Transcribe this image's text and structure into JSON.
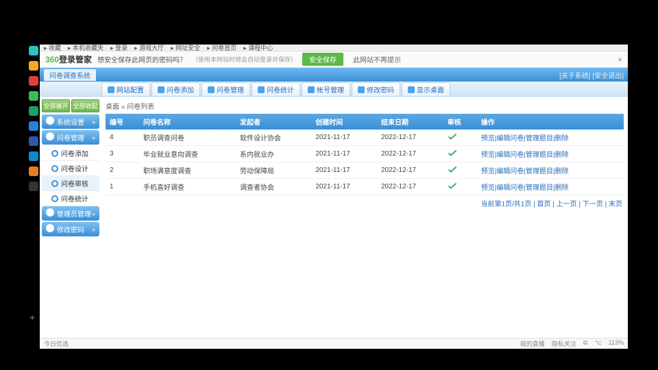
{
  "topstrip": [
    "收藏",
    "本机收藏夹",
    "登录",
    "游戏大厅",
    "网址安全",
    "问卷首页",
    "课程中心"
  ],
  "savebar": {
    "logo_a": "360",
    "logo_b": "登录管家",
    "question": "想安全保存此网页的密码吗？",
    "hint": "（使用本网站时将会自动登录并保存）",
    "save": "安全保存",
    "never": "此网站不再提示"
  },
  "titlebar": {
    "system": "问卷调查系统",
    "rightlinks": "[关于系统] [安全退出]"
  },
  "tabs": [
    "网站配置",
    "问卷添加",
    "问卷管理",
    "问卷统计",
    "帐号管理",
    "修改密码",
    "显示桌面"
  ],
  "sidebar": {
    "top": [
      "全部展开",
      "全部收起"
    ],
    "groups": [
      {
        "label": "系统设置",
        "items": []
      },
      {
        "label": "问卷管理",
        "items": [
          "问卷添加",
          "问卷设计",
          "问卷审核",
          "问卷统计"
        ],
        "active_index": 2
      },
      {
        "label": "管理员管理",
        "items": []
      },
      {
        "label": "修改密码",
        "items": []
      }
    ]
  },
  "breadcrumb": "桌面 » 问卷列表",
  "columns": [
    "编号",
    "问卷名称",
    "发起者",
    "创建时间",
    "结束日期",
    "审核",
    "操作"
  ],
  "rows": [
    {
      "id": "4",
      "name": "职员调查问卷",
      "owner": "软件设计协会",
      "created": "2021-11-17",
      "end": "2022-12-17"
    },
    {
      "id": "3",
      "name": "毕业就业意向调查",
      "owner": "系内就业办",
      "created": "2021-11-17",
      "end": "2022-12-17"
    },
    {
      "id": "2",
      "name": "职场满意度调查",
      "owner": "劳动保障局",
      "created": "2021-11-17",
      "end": "2022-12-17"
    },
    {
      "id": "1",
      "name": "手机喜好调查",
      "owner": "调查者协会",
      "created": "2021-11-17",
      "end": "2022-12-17"
    }
  ],
  "ops_text": "预览|编辑问卷|管理题目|删除",
  "pager": "当前第1页/共1页 | 首页 | 上一页 | 下一页 | 末页",
  "statusbar": {
    "left": "今日优选",
    "right": [
      "我的直播",
      "隐私关注"
    ],
    "zoom": "113%"
  },
  "icon_colors": [
    "#2fc0c2",
    "#f5a623",
    "#e04040",
    "#3cbb59",
    "#1f9e6a",
    "#2a7fd6",
    "#3355aa",
    "#1188cc",
    "#e67e22",
    "#333"
  ]
}
